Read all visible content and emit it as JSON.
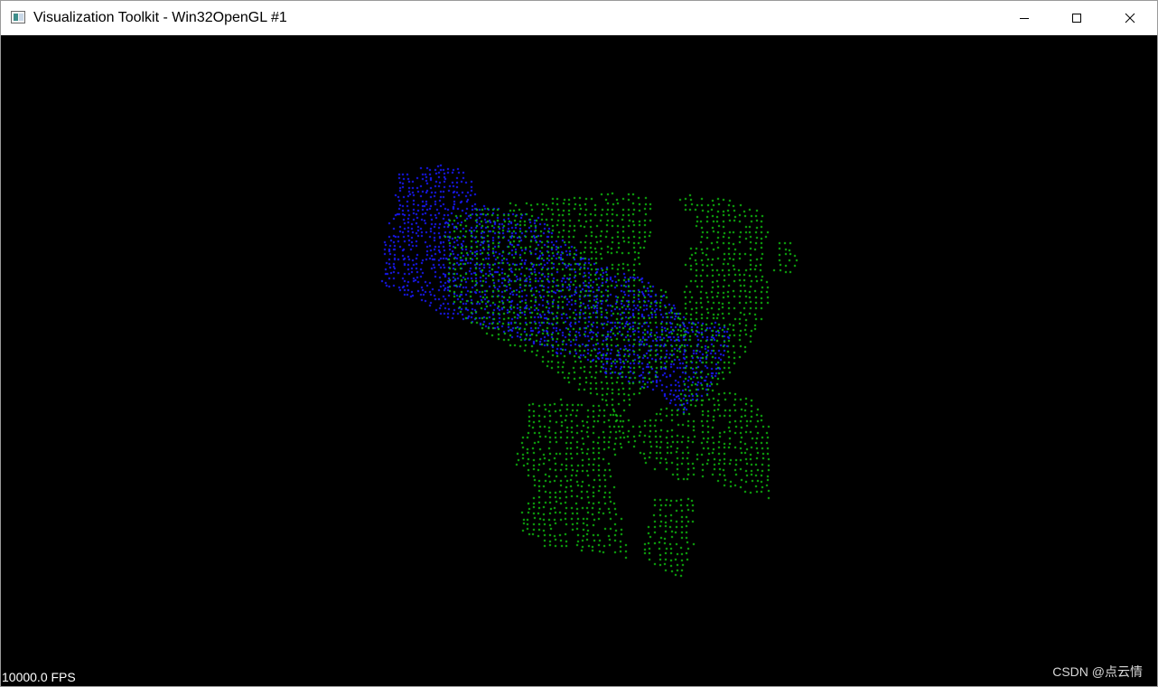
{
  "window": {
    "title": "Visualization Toolkit - Win32OpenGL #1",
    "icon": "vtk-window-icon",
    "controls": [
      "minimize-icon",
      "maximize-icon",
      "close-icon"
    ]
  },
  "viewport": {
    "background": "#000000",
    "fps_text": "10000.0 FPS",
    "watermark": "CSDN @点云情"
  },
  "point_clouds": [
    {
      "name": "",
      "color": "#10c010"
    },
    {
      "name": "",
      "color": "#1a1aff"
    }
  ]
}
